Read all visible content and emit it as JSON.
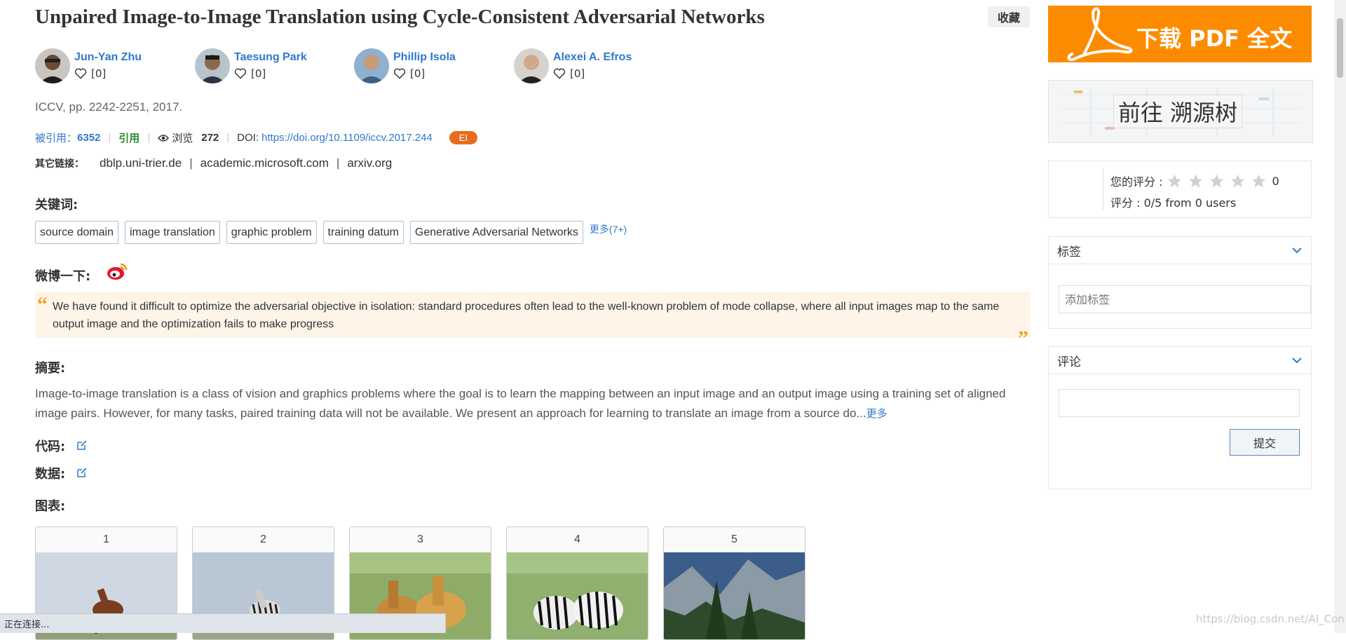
{
  "paper": {
    "title": "Unpaired Image-to-Image Translation using Cycle-Consistent Adversarial Networks",
    "favorite_label": "收藏",
    "authors": [
      {
        "name": "Jun-Yan Zhu",
        "likes": "[0]"
      },
      {
        "name": "Taesung Park",
        "likes": "[0]"
      },
      {
        "name": "Phillip Isola",
        "likes": "[0]"
      },
      {
        "name": "Alexei A. Efros",
        "likes": "[0]"
      }
    ],
    "venue": "ICCV, pp. 2242-2251, 2017.",
    "stats": {
      "cited_label": "被引用：",
      "cited_count": "6352",
      "cite_label": "引用",
      "views_label": "浏览",
      "views_count": "272",
      "doi_label": "DOI:",
      "doi_link": "https://doi.org/10.1109/iccv.2017.244",
      "ei_badge": "EI"
    },
    "other_links": {
      "label": "其它链接：",
      "links": [
        "dblp.uni-trier.de",
        "academic.microsoft.com",
        "arxiv.org"
      ]
    },
    "keywords_label": "关键词:",
    "keywords": [
      "source domain",
      "image translation",
      "graphic problem",
      "training datum",
      "Generative Adversarial Networks"
    ],
    "keywords_more": "更多(7+)",
    "weibo_label": "微博一下:",
    "quote": "We have found it difficult to optimize the adversarial objective in isolation: standard procedures often lead to the well-known problem of mode collapse, where all input images map to the same output image and the optimization fails to make progress",
    "abstract_label": "摘要:",
    "abstract": "Image-to-image translation is a class of vision and graphics problems where the goal is to learn the mapping between an input image and an output image using a training set of aligned image pairs. However, for many tasks, paired training data will not be available. We present an approach for learning to translate an image from a source do...",
    "abstract_more": "更多",
    "code_label": "代码:",
    "data_label": "数据:",
    "figures_label": "图表:",
    "figures": [
      "1",
      "2",
      "3",
      "4",
      "5"
    ]
  },
  "sidebar": {
    "pdf_button": "下载 PDF 全文",
    "tree_button": "前往 溯源树",
    "rating": {
      "your_rating_label": "您的评分 :",
      "your_rating_value": "0",
      "overall": "评分 : 0/5 from 0 users",
      "stars": 5
    },
    "tags": {
      "title": "标签",
      "placeholder": "添加标签"
    },
    "comments": {
      "title": "评论",
      "submit": "提交"
    }
  },
  "status_bar": "正在连接...",
  "watermark": "https://blog.csdn.net/AI_Con",
  "colors": {
    "link": "#2f78cd",
    "pdf_orange": "#fd8b00",
    "ei_orange": "#e96b1e",
    "quote_bg": "#fef4e8",
    "quote_mark": "#f1a02c",
    "cite_green": "#2a8c34"
  }
}
